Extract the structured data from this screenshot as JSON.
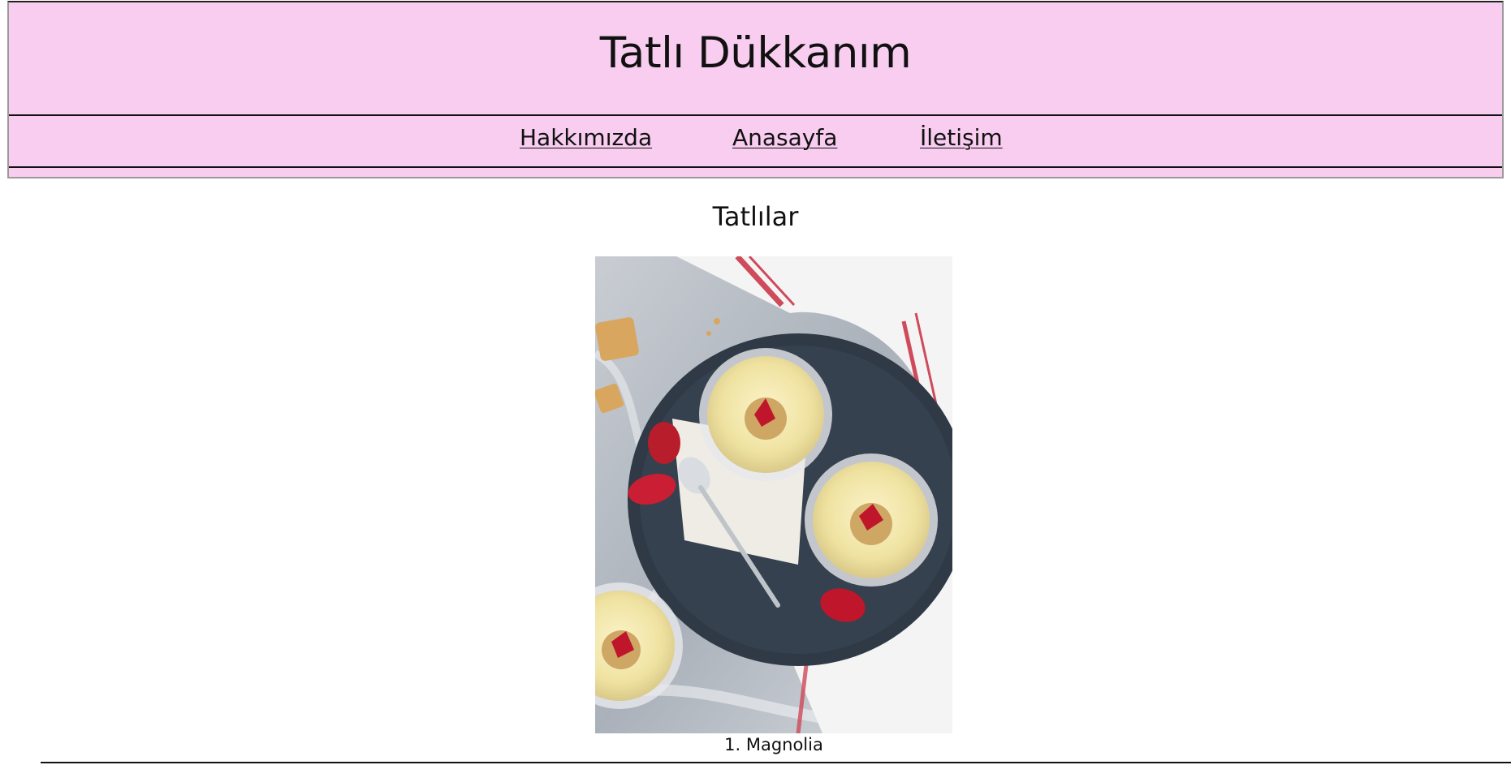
{
  "header": {
    "title": "Tatlı Dükkanım"
  },
  "nav": {
    "items": [
      {
        "label": "Hakkımızda"
      },
      {
        "label": "Anasayfa"
      },
      {
        "label": "İletişim"
      }
    ]
  },
  "main": {
    "section_title": "Tatlılar",
    "products": [
      {
        "caption": "1. Magnolia",
        "image": "magnolia-dessert-photo"
      }
    ]
  },
  "colors": {
    "header_bg": "#f8cdf0"
  }
}
